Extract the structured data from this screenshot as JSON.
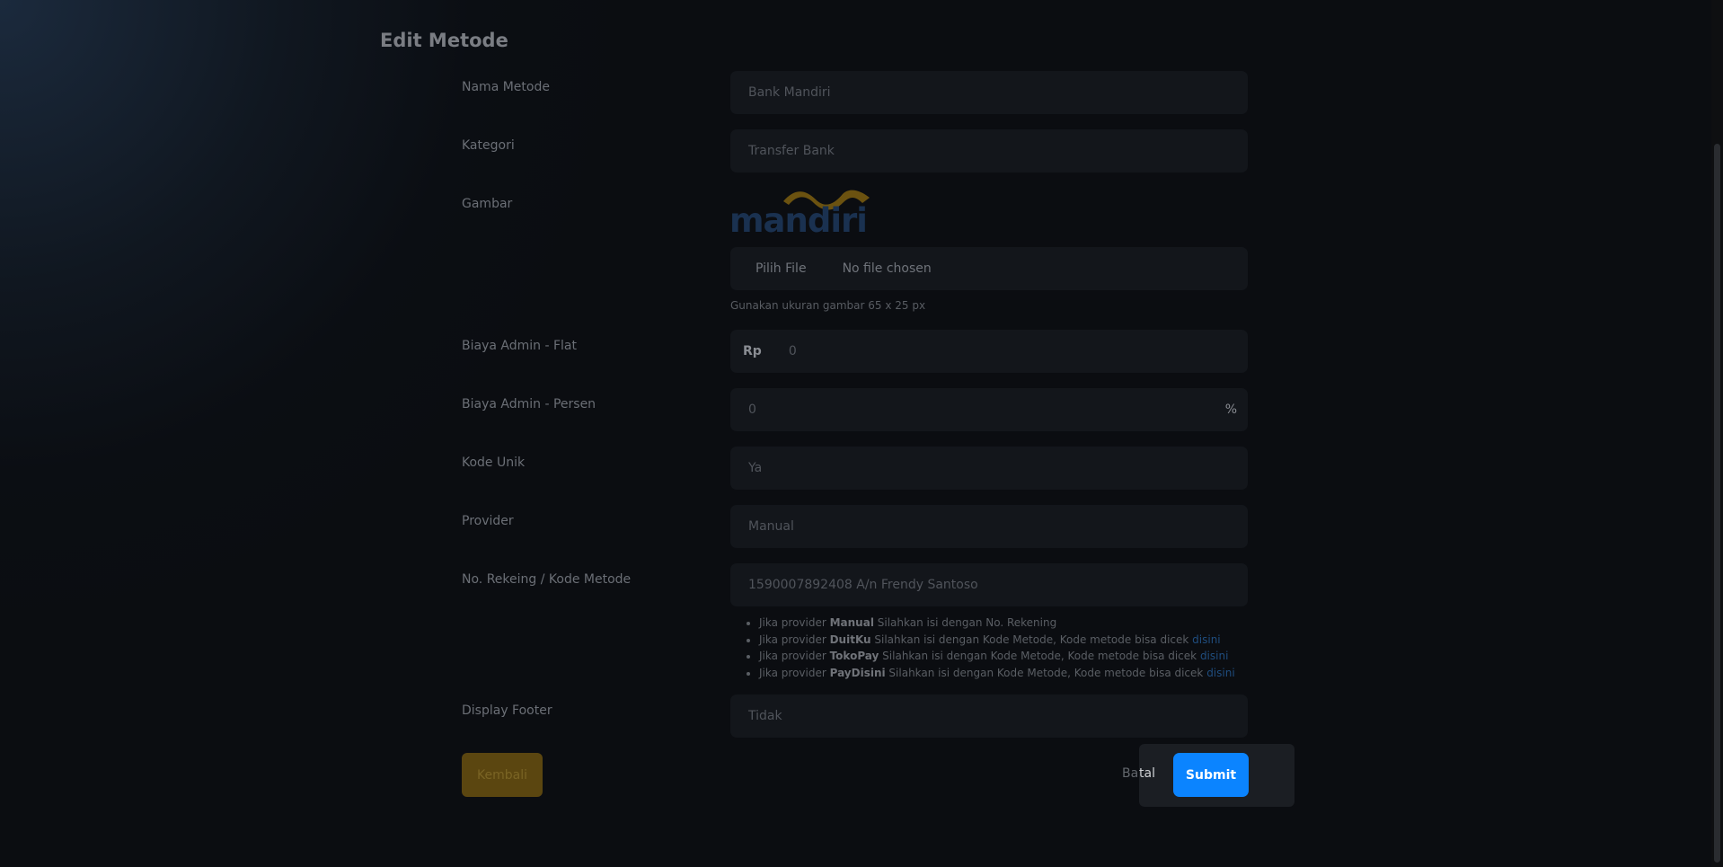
{
  "page": {
    "title": "Edit Metode"
  },
  "form": {
    "nama_metode": {
      "label": "Nama Metode",
      "value": "Bank Mandiri"
    },
    "kategori": {
      "label": "Kategori",
      "value": "Transfer Bank"
    },
    "gambar": {
      "label": "Gambar",
      "logo_text": "mandiri",
      "file_button": "Pilih File",
      "file_status": "No file chosen",
      "hint": "Gunakan ukuran gambar 65 x 25 px"
    },
    "biaya_flat": {
      "label": "Biaya Admin - Flat",
      "prefix": "Rp",
      "value": "0"
    },
    "biaya_persen": {
      "label": "Biaya Admin - Persen",
      "value": "0",
      "suffix": "%"
    },
    "kode_unik": {
      "label": "Kode Unik",
      "value": "Ya"
    },
    "provider": {
      "label": "Provider",
      "value": "Manual"
    },
    "rekening": {
      "label": "No. Rekeing / Kode Metode",
      "value": "1590007892408 A/n Frendy Santoso"
    },
    "notes": [
      {
        "pre": "Jika provider ",
        "bold": "Manual",
        "post": " Silahkan isi dengan No. Rekening",
        "link": ""
      },
      {
        "pre": "Jika provider ",
        "bold": "DuitKu",
        "post": " Silahkan isi dengan Kode Metode, Kode metode bisa dicek ",
        "link": "disini"
      },
      {
        "pre": "Jika provider ",
        "bold": "TokoPay",
        "post": " Silahkan isi dengan Kode Metode, Kode metode bisa dicek ",
        "link": "disini"
      },
      {
        "pre": "Jika provider ",
        "bold": "PayDisini",
        "post": " Silahkan isi dengan Kode Metode, Kode metode bisa dicek ",
        "link": "disini"
      }
    ],
    "display_footer": {
      "label": "Display Footer",
      "value": "Tidak"
    }
  },
  "buttons": {
    "back": "Kembali",
    "cancel_a": "Ba",
    "cancel_b": "tal",
    "submit": "Submit"
  },
  "colors": {
    "accent": "#0b84ff",
    "back_button": "#5b4610",
    "logo_wave": "#6b5210",
    "logo_text": "#1a3150"
  }
}
